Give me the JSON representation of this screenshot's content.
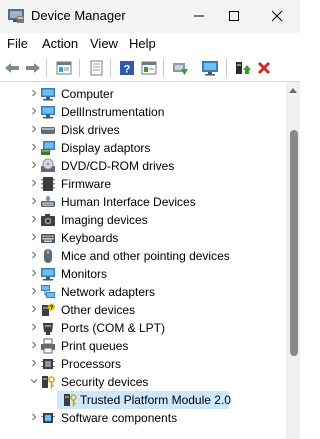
{
  "window": {
    "title": "Device Manager"
  },
  "menu": {
    "file": "File",
    "action": "Action",
    "view": "View",
    "help": "Help"
  },
  "toolbar": {
    "icons": [
      "back-arrow-icon",
      "forward-arrow-icon",
      "properties-icon",
      "scan-icon",
      "help-icon",
      "view-icon",
      "update-driver-icon",
      "monitor-icon",
      "enable-device-icon",
      "uninstall-icon"
    ]
  },
  "tree": {
    "items": [
      {
        "label": "Computer",
        "icon": "computer-icon"
      },
      {
        "label": "DellInstrumentation",
        "icon": "monitor-icon"
      },
      {
        "label": "Disk drives",
        "icon": "disk-drive-icon"
      },
      {
        "label": "Display adaptors",
        "icon": "display-adapter-icon"
      },
      {
        "label": "DVD/CD-ROM drives",
        "icon": "dvd-drive-icon"
      },
      {
        "label": "Firmware",
        "icon": "firmware-icon"
      },
      {
        "label": "Human Interface Devices",
        "icon": "hid-icon"
      },
      {
        "label": "Imaging devices",
        "icon": "camera-icon"
      },
      {
        "label": "Keyboards",
        "icon": "keyboard-icon"
      },
      {
        "label": "Mice and other pointing devices",
        "icon": "mouse-icon"
      },
      {
        "label": "Monitors",
        "icon": "monitor-icon"
      },
      {
        "label": "Network adapters",
        "icon": "network-adapter-icon"
      },
      {
        "label": "Other devices",
        "icon": "other-devices-icon"
      },
      {
        "label": "Ports (COM & LPT)",
        "icon": "port-icon"
      },
      {
        "label": "Print queues",
        "icon": "printer-icon"
      },
      {
        "label": "Processors",
        "icon": "processor-icon"
      },
      {
        "label": "Security devices",
        "icon": "security-device-icon",
        "expanded": true
      },
      {
        "label": "Trusted Platform Module 2.0",
        "icon": "tpm-icon",
        "child": true,
        "selected": true
      },
      {
        "label": "Software components",
        "icon": "software-component-icon"
      }
    ]
  },
  "colors": {
    "selection": "#cce8ff",
    "close_red": "#d7262a",
    "green": "#3c9a2e",
    "help_blue": "#2f5aa8"
  }
}
